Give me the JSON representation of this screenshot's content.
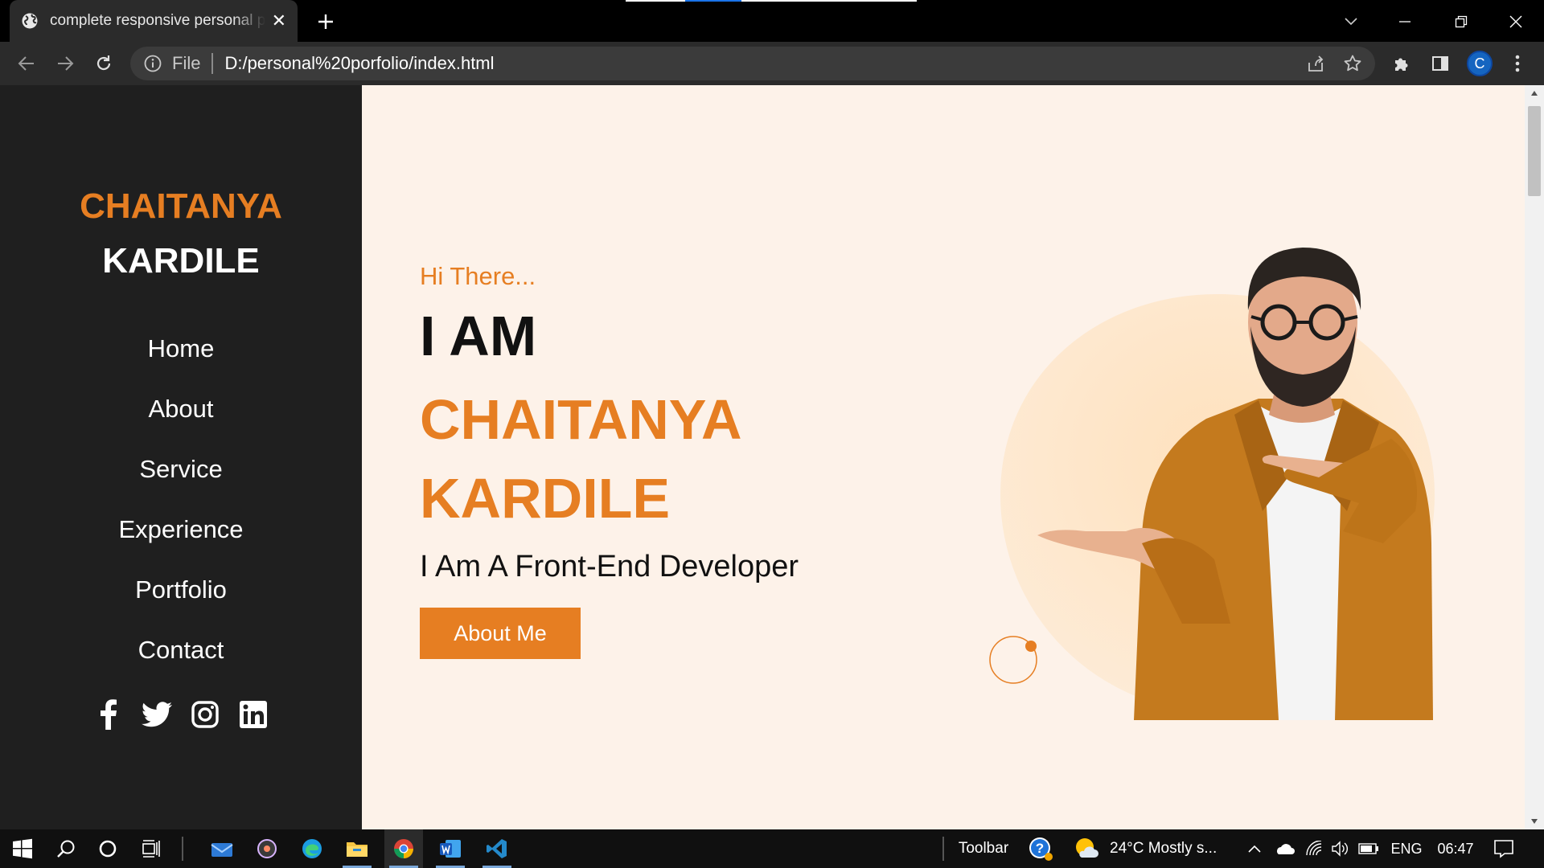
{
  "browser": {
    "tab_title": "complete responsive personal portfolio",
    "tab_close": "✕",
    "new_tab": "+",
    "address_scheme_label": "File",
    "address_url": "D:/personal%20porfolio/index.html",
    "profile_initial": "C"
  },
  "site": {
    "logo_first": "CHAITANYA",
    "logo_last": "KARDILE",
    "nav": [
      "Home",
      "About",
      "Service",
      "Experience",
      "Portfolio",
      "Contact"
    ],
    "social_icons": [
      "facebook-icon",
      "twitter-icon",
      "instagram-icon",
      "linkedin-icon"
    ],
    "greeting": "Hi There...",
    "intro": "I AM",
    "name_first": "CHAITANYA",
    "name_last": "KARDILE",
    "role": "I Am A Front-End Developer",
    "cta_label": "About Me",
    "accent_color": "#e67e22",
    "sidebar_color": "#1f1f1f",
    "page_bg": "#fdf2e9"
  },
  "taskbar": {
    "toolbar_label": "Toolbar",
    "weather": "24°C  Mostly s...",
    "language": "ENG",
    "time": "06:47"
  }
}
